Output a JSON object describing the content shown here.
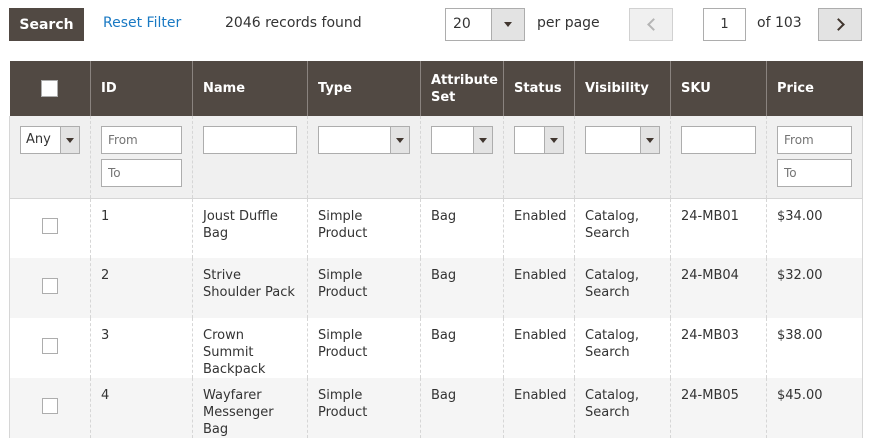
{
  "toolbar": {
    "search_label": "Search",
    "reset_label": "Reset Filter",
    "records_found": "2046 records found",
    "per_page_value": "20",
    "per_page_label": "per page",
    "current_page": "1",
    "of_pages": "of 103"
  },
  "columns": {
    "id": "ID",
    "name": "Name",
    "type": "Type",
    "attribute_set": "Attribute Set",
    "status": "Status",
    "visibility": "Visibility",
    "sku": "SKU",
    "price": "Price"
  },
  "filters": {
    "store_any": "Any",
    "id_from_placeholder": "From",
    "id_to_placeholder": "To",
    "price_from_placeholder": "From",
    "price_to_placeholder": "To"
  },
  "rows": [
    {
      "id": "1",
      "name": "Joust Duffle Bag",
      "type": "Simple Product",
      "attribute_set": "Bag",
      "status": "Enabled",
      "visibility": "Catalog, Search",
      "sku": "24-MB01",
      "price": "$34.00"
    },
    {
      "id": "2",
      "name": "Strive Shoulder Pack",
      "type": "Simple Product",
      "attribute_set": "Bag",
      "status": "Enabled",
      "visibility": "Catalog, Search",
      "sku": "24-MB04",
      "price": "$32.00"
    },
    {
      "id": "3",
      "name": "Crown Summit Backpack",
      "type": "Simple Product",
      "attribute_set": "Bag",
      "status": "Enabled",
      "visibility": "Catalog, Search",
      "sku": "24-MB03",
      "price": "$38.00"
    },
    {
      "id": "4",
      "name": "Wayfarer Messenger Bag",
      "type": "Simple Product",
      "attribute_set": "Bag",
      "status": "Enabled",
      "visibility": "Catalog, Search",
      "sku": "24-MB05",
      "price": "$45.00"
    }
  ],
  "colors": {
    "header_bg": "#514943",
    "link": "#1979c3",
    "filter_bg": "#f0f0f0",
    "stripe_bg": "#f5f5f5"
  },
  "icons": {
    "prev": "chevron-left-icon",
    "next": "chevron-right-icon",
    "dropdown": "caret-down-icon"
  }
}
